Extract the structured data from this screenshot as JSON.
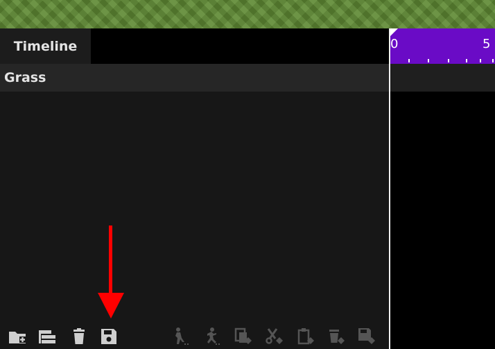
{
  "header": {
    "timeline_tab": "Timeline"
  },
  "ruler": {
    "labels": [
      "0",
      "5"
    ],
    "background": "#6a0bc6"
  },
  "track": {
    "name": "Grass"
  },
  "toolbar": {
    "buttons": [
      {
        "icon": "add-folder-icon",
        "enabled": true
      },
      {
        "icon": "duplicate-layers-icon",
        "enabled": true
      },
      {
        "icon": "trash-icon",
        "enabled": true
      },
      {
        "icon": "save-icon",
        "enabled": true
      },
      {
        "icon": "add-keyframe-icon",
        "enabled": false
      },
      {
        "icon": "add-animation-icon",
        "enabled": false
      },
      {
        "icon": "copy-keyframe-icon",
        "enabled": false
      },
      {
        "icon": "cut-keyframe-icon",
        "enabled": false
      },
      {
        "icon": "paste-keyframe-icon",
        "enabled": false
      },
      {
        "icon": "delete-keyframe-icon",
        "enabled": false
      },
      {
        "icon": "save-keyframe-icon",
        "enabled": false
      }
    ]
  },
  "annotation": {
    "arrow_color": "#ff0000",
    "points_to": "save-icon"
  }
}
